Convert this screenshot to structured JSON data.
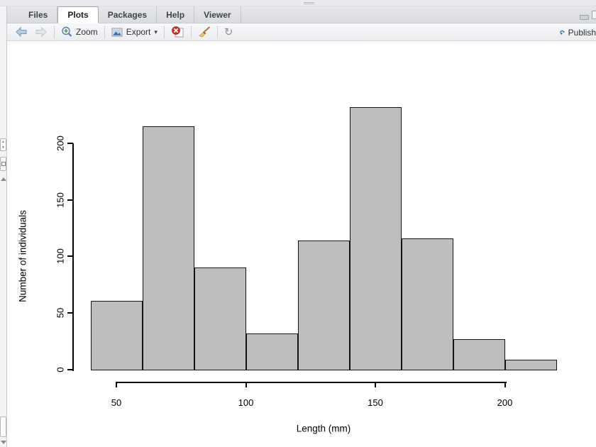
{
  "window": {
    "minimize_icon": "minimize",
    "maximize_icon": "maximize",
    "splitter_handle": "pane-drag-handle"
  },
  "tabs": [
    {
      "label": "Files",
      "active": false
    },
    {
      "label": "Plots",
      "active": true
    },
    {
      "label": "Packages",
      "active": false
    },
    {
      "label": "Help",
      "active": false
    },
    {
      "label": "Viewer",
      "active": false
    }
  ],
  "toolbar": {
    "back_icon": "back-arrow",
    "forward_icon": "forward-arrow",
    "zoom_label": "Zoom",
    "export_label": "Export",
    "export_caret": "▾",
    "remove_plot_icon": "remove-plot",
    "clear_all_icon": "broom",
    "refresh_icon": "↻",
    "publish_label": "Publish"
  },
  "colors": {
    "bar_fill": "#bebebe",
    "bar_border": "#141414",
    "chrome_bg": "#e6e7ea",
    "toolbar_bg": "#f2f3f6",
    "publish_blue": "#3d76ad",
    "accent_green": "#3fae49",
    "danger_red": "#d93025"
  },
  "chart_data": {
    "type": "bar",
    "subtype": "histogram",
    "title": "",
    "xlabel": "Length (mm)",
    "ylabel": "Number of individuals",
    "bin_edges": [
      40,
      60,
      80,
      100,
      120,
      140,
      160,
      180,
      200,
      220
    ],
    "counts": [
      61,
      215,
      90,
      32,
      114,
      232,
      116,
      27,
      9
    ],
    "x_ticks": [
      50,
      100,
      150,
      200
    ],
    "y_ticks": [
      0,
      50,
      100,
      150,
      200
    ],
    "xlim": [
      40,
      220
    ],
    "ylim": [
      0,
      240
    ],
    "grid": false,
    "legend": "none",
    "bar_fill": "#bebebe",
    "bar_border": "#000000"
  }
}
